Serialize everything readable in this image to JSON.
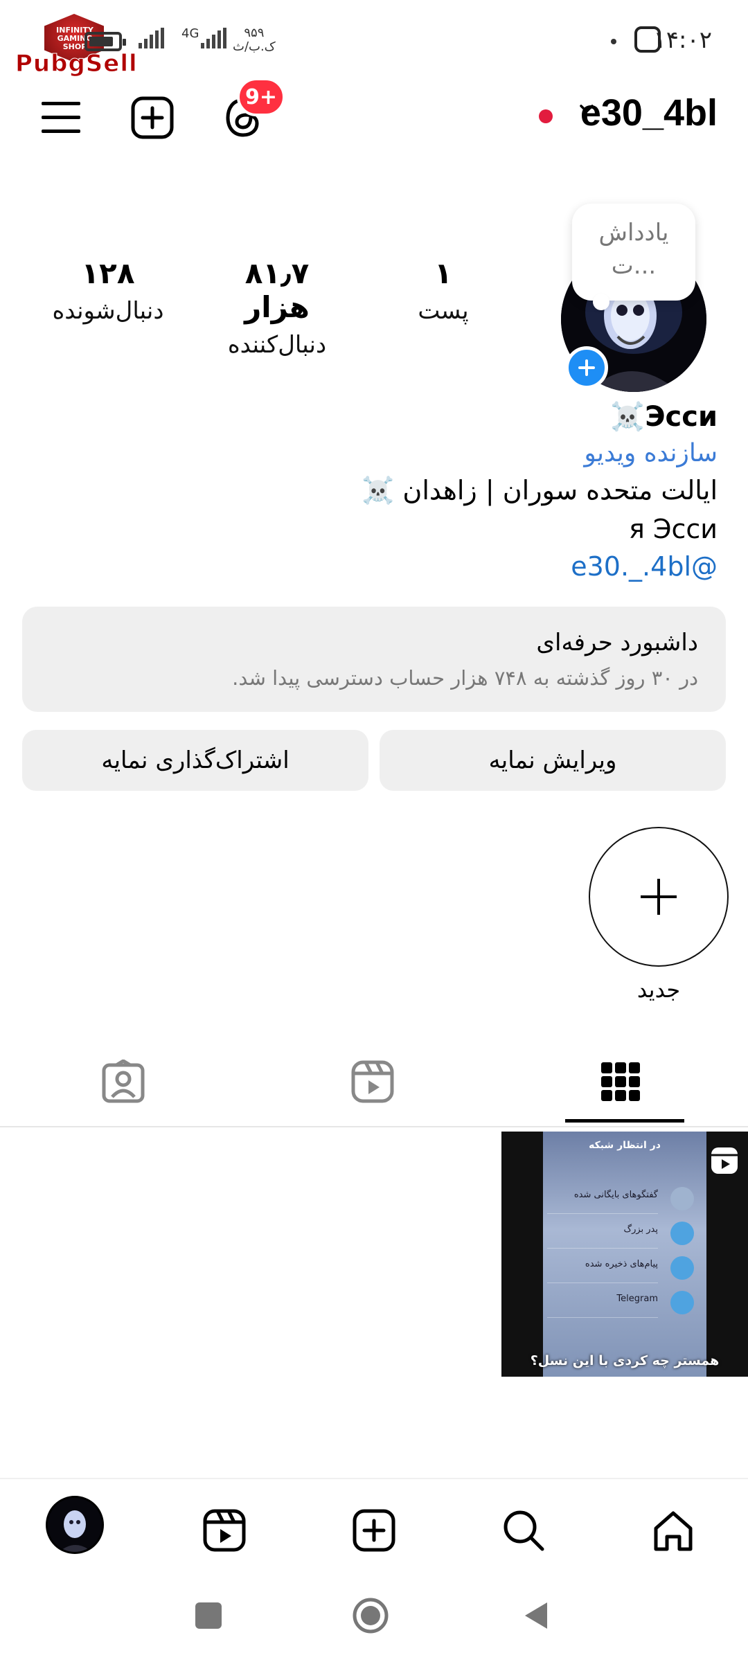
{
  "status_bar": {
    "time": "۱۴:۰۲",
    "network": "4G",
    "speed_value": "۹۵۹",
    "speed_unit": "ک.ب/ث",
    "battery_percent": 0.75
  },
  "watermark": {
    "brand": "PubgSell",
    "badge_text": "INFINITY GAMING SHOP"
  },
  "header": {
    "username": "e30_4bl",
    "threads_badge": "9+"
  },
  "profile": {
    "note_line1": "یادداش",
    "note_line2": "ت...",
    "stats": [
      {
        "value": "۱",
        "label": "پست"
      },
      {
        "value": "۸۱٫۷ هزار",
        "label": "دنبال‌کننده"
      },
      {
        "value": "۱۲۸",
        "label": "دنبال‌شونده"
      }
    ],
    "name": "Эсси☠️",
    "category": "سازنده ویدیو",
    "location": "ایالت متحده سوران | زاهدان ☠️",
    "bio": "я Эсси",
    "threads_handle": "e30._.4bl@"
  },
  "dashboard": {
    "title": "داشبورد حرفه‌ای",
    "subtitle": "در ۳۰ روز گذشته به ۷۴۸ هزار حساب دسترسی پیدا شد."
  },
  "actions": {
    "edit_profile": "ویرایش نمایه",
    "share_profile": "اشتراک‌گذاری نمایه"
  },
  "highlights": {
    "new_label": "جدید"
  },
  "tabs": [
    "grid",
    "reels",
    "tagged"
  ],
  "post": {
    "caption": "همستر چه کردی با این نسل؟",
    "screen_title": "در انتظار شبکه",
    "rows": [
      "گفتگوهای بایگانی شده",
      "پدر بزرگ",
      "پیام‌های ذخیره شده",
      "Telegram"
    ]
  },
  "colors": {
    "accent_blue": "#1e8ef5",
    "badge_red": "#ff3040",
    "link_blue": "#1d6fc7"
  }
}
